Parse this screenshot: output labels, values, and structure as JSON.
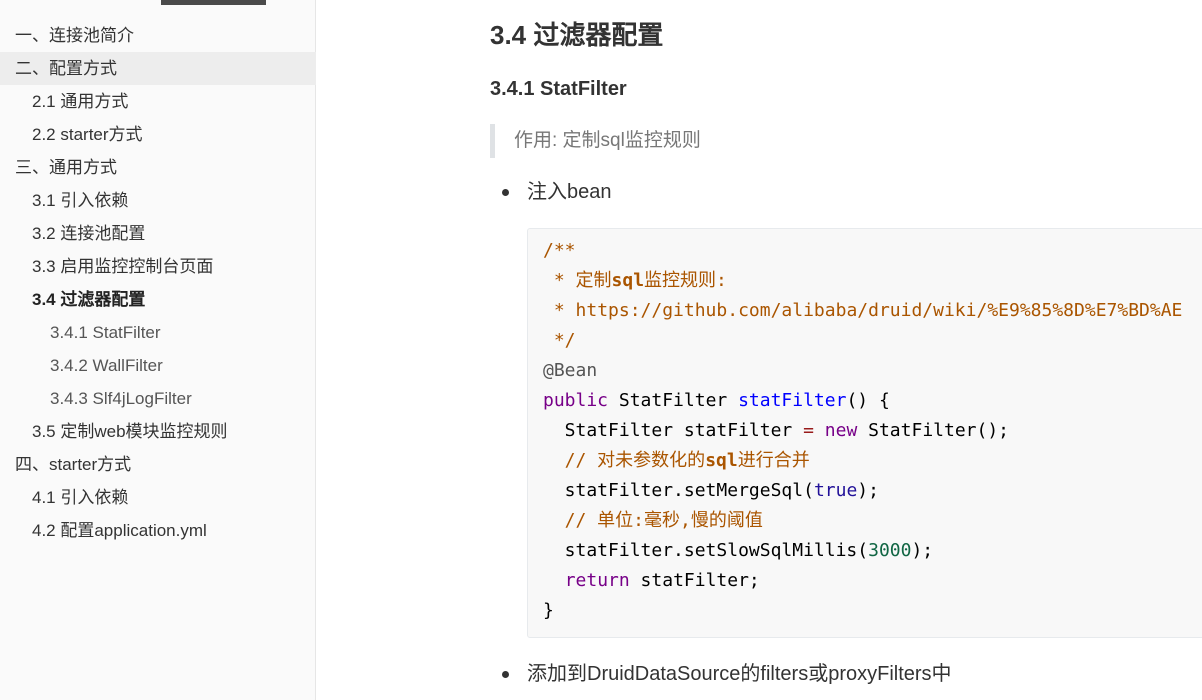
{
  "toc": {
    "items": [
      {
        "level": 1,
        "label": "一、连接池简介",
        "state": ""
      },
      {
        "level": 1,
        "label": "二、配置方式",
        "state": "hover"
      },
      {
        "level": 2,
        "label": "2.1 通用方式",
        "state": ""
      },
      {
        "level": 2,
        "label": "2.2 starter方式",
        "state": ""
      },
      {
        "level": 1,
        "label": "三、通用方式",
        "state": ""
      },
      {
        "level": 2,
        "label": "3.1 引入依赖",
        "state": ""
      },
      {
        "level": 2,
        "label": "3.2 连接池配置",
        "state": ""
      },
      {
        "level": 2,
        "label": "3.3 启用监控控制台页面",
        "state": ""
      },
      {
        "level": 2,
        "label": "3.4 过滤器配置",
        "state": "active"
      },
      {
        "level": 3,
        "label": "3.4.1 StatFilter",
        "state": ""
      },
      {
        "level": 3,
        "label": "3.4.2 WallFilter",
        "state": ""
      },
      {
        "level": 3,
        "label": "3.4.3 Slf4jLogFilter",
        "state": ""
      },
      {
        "level": 2,
        "label": "3.5 定制web模块监控规则",
        "state": ""
      },
      {
        "level": 1,
        "label": "四、starter方式",
        "state": ""
      },
      {
        "level": 2,
        "label": "4.1 引入依赖",
        "state": ""
      },
      {
        "level": 2,
        "label": "4.2 配置application.yml",
        "state": ""
      }
    ]
  },
  "content": {
    "section_title": "3.4 过滤器配置",
    "sub_title": "3.4.1 StatFilter",
    "quote": "作用: 定制sql监控规则",
    "bullet_1": "注入bean",
    "bullet_2": "添加到DruidDataSource的filters或proxyFilters中"
  },
  "code": {
    "lines": [
      [
        {
          "t": "/**",
          "c": "c-comment"
        }
      ],
      [
        {
          "t": " * 定制",
          "c": "c-comment"
        },
        {
          "t": "sql",
          "c": "c-comment c-bold"
        },
        {
          "t": "监控规则:",
          "c": "c-comment"
        }
      ],
      [
        {
          "t": " * ",
          "c": "c-comment"
        },
        {
          "t": "https://github.com/alibaba/druid/wiki/%E9%85%8D%E7%BD%AE",
          "c": "c-url"
        }
      ],
      [
        {
          "t": " */",
          "c": "c-comment"
        }
      ],
      [
        {
          "t": "@Bean",
          "c": "c-annot"
        }
      ],
      [
        {
          "t": "public",
          "c": "c-keyword"
        },
        {
          "t": " StatFilter ",
          "c": "c-type"
        },
        {
          "t": "statFilter",
          "c": "c-method"
        },
        {
          "t": "() {",
          "c": "c-plain"
        }
      ],
      [
        {
          "t": "  StatFilter statFilter ",
          "c": "c-plain"
        },
        {
          "t": "=",
          "c": "c-op"
        },
        {
          "t": " ",
          "c": "c-plain"
        },
        {
          "t": "new",
          "c": "c-keyword"
        },
        {
          "t": " StatFilter();",
          "c": "c-plain"
        }
      ],
      [
        {
          "t": "  // 对未参数化的",
          "c": "c-comment"
        },
        {
          "t": "sql",
          "c": "c-comment c-bold"
        },
        {
          "t": "进行合并",
          "c": "c-comment"
        }
      ],
      [
        {
          "t": "  statFilter.setMergeSql(",
          "c": "c-plain"
        },
        {
          "t": "true",
          "c": "c-atom"
        },
        {
          "t": ");",
          "c": "c-plain"
        }
      ],
      [
        {
          "t": "  // 单位:毫秒,慢的阈值",
          "c": "c-comment"
        }
      ],
      [
        {
          "t": "  statFilter.setSlowSqlMillis(",
          "c": "c-plain"
        },
        {
          "t": "3000",
          "c": "c-number"
        },
        {
          "t": ");",
          "c": "c-plain"
        }
      ],
      [
        {
          "t": "  ",
          "c": "c-plain"
        },
        {
          "t": "return",
          "c": "c-keyword"
        },
        {
          "t": " statFilter;",
          "c": "c-plain"
        }
      ],
      [
        {
          "t": "}",
          "c": "c-plain"
        }
      ]
    ]
  }
}
